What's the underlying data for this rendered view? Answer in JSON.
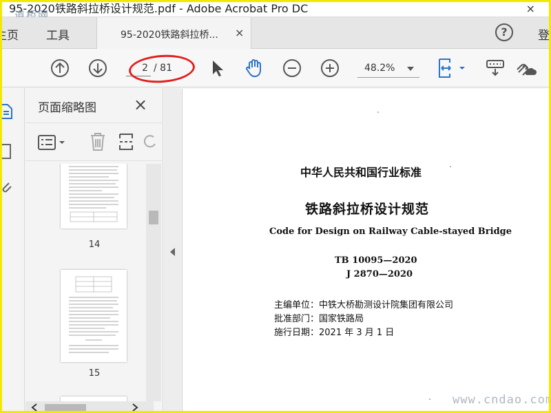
{
  "window": {
    "title": "95-2020铁路斜拉桥设计规范.pdf - Adobe Acrobat Pro DC",
    "close_glyph": "×",
    "watermark_logo": "道桥网"
  },
  "tabs": {
    "home": "主页",
    "tools": "工具",
    "document": "95-2020铁路斜拉桥...",
    "document_close": "×",
    "help": "?",
    "login": "登"
  },
  "toolbar": {
    "current_page": "2",
    "total_pages": "/ 81",
    "zoom": "48.2%"
  },
  "thumbnails": {
    "title": "页面缩略图",
    "close": "×",
    "pages": [
      {
        "number": "14"
      },
      {
        "number": "15"
      }
    ]
  },
  "document": {
    "heading1": "中华人民共和国行业标准",
    "heading2": "铁路斜拉桥设计规范",
    "english_title": "Code for Design on Railway Cable-stayed Bridge",
    "code1": "TB 10095—2020",
    "code2": "J 2870—2020",
    "org_line": "主编单位：中铁大桥勘测设计院集团有限公司",
    "approve_line": "批准部门：国家铁路局",
    "date_line": "施行日期：2021 年 3 月 1 日"
  },
  "site_watermark": "www.cndao.com",
  "colors": {
    "accent_blue": "#2c72c7",
    "highlight_red": "#e02020",
    "frame_yellow": "#f3e800"
  }
}
